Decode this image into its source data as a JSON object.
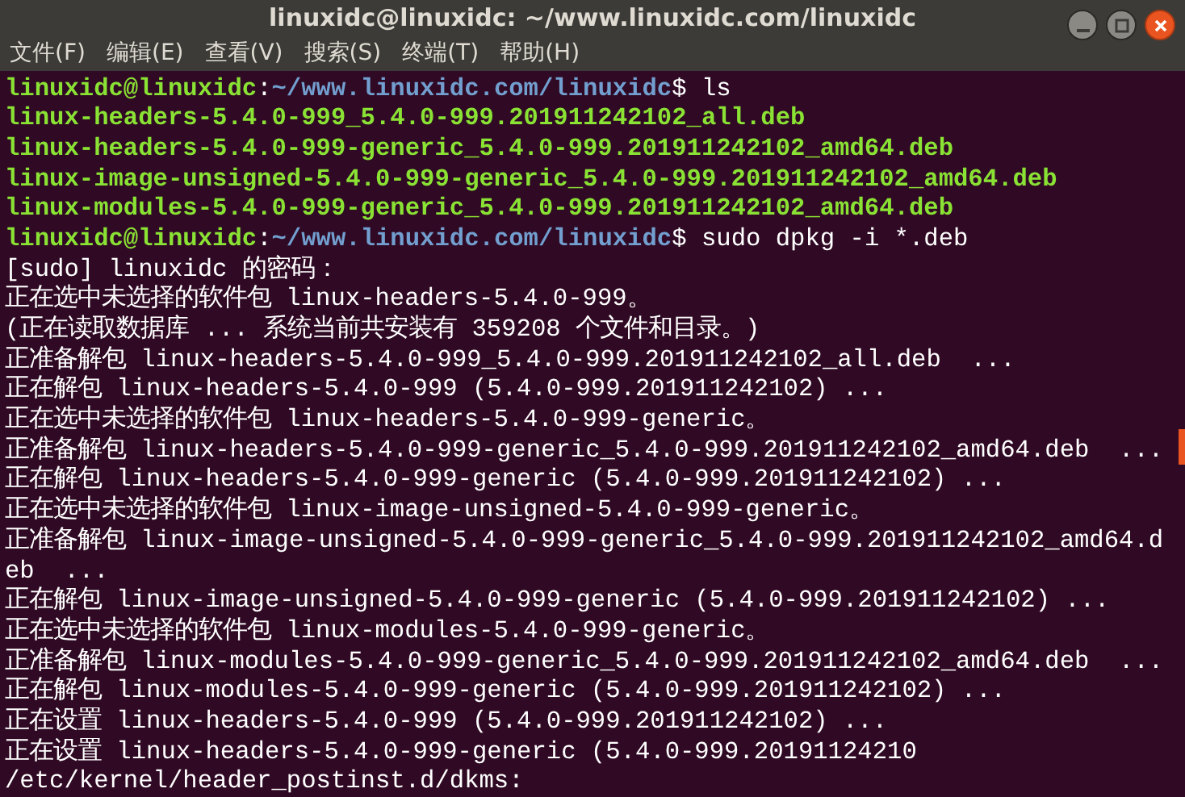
{
  "window": {
    "title": "linuxidc@linuxidc: ~/www.linuxidc.com/linuxidc"
  },
  "menu": [
    "文件(F)",
    "编辑(E)",
    "查看(V)",
    "搜索(S)",
    "终端(T)",
    "帮助(H)"
  ],
  "terminal": {
    "lines": [
      [
        {
          "kind": "user",
          "text": "linuxidc@linuxidc"
        },
        {
          "kind": "plain",
          "text": ":"
        },
        {
          "kind": "path",
          "text": "~/www.linuxidc.com/linuxidc"
        },
        {
          "kind": "plain",
          "text": "$ ls"
        }
      ],
      [
        {
          "kind": "file",
          "text": "linux-headers-5.4.0-999_5.4.0-999.201911242102_all.deb"
        }
      ],
      [
        {
          "kind": "file",
          "text": "linux-headers-5.4.0-999-generic_5.4.0-999.201911242102_amd64.deb"
        }
      ],
      [
        {
          "kind": "file",
          "text": "linux-image-unsigned-5.4.0-999-generic_5.4.0-999.201911242102_amd64.deb"
        }
      ],
      [
        {
          "kind": "file",
          "text": "linux-modules-5.4.0-999-generic_5.4.0-999.201911242102_amd64.deb"
        }
      ],
      [
        {
          "kind": "user",
          "text": "linuxidc@linuxidc"
        },
        {
          "kind": "plain",
          "text": ":"
        },
        {
          "kind": "path",
          "text": "~/www.linuxidc.com/linuxidc"
        },
        {
          "kind": "plain",
          "text": "$ sudo dpkg -i *.deb"
        }
      ],
      [
        {
          "kind": "plain",
          "text": "[sudo] linuxidc 的密码："
        }
      ],
      [
        {
          "kind": "plain",
          "text": "正在选中未选择的软件包 linux-headers-5.4.0-999。"
        }
      ],
      [
        {
          "kind": "plain",
          "text": "(正在读取数据库 ... 系统当前共安装有 359208 个文件和目录。)"
        }
      ],
      [
        {
          "kind": "plain",
          "text": "正准备解包 linux-headers-5.4.0-999_5.4.0-999.201911242102_all.deb  ..."
        }
      ],
      [
        {
          "kind": "plain",
          "text": "正在解包 linux-headers-5.4.0-999 (5.4.0-999.201911242102) ..."
        }
      ],
      [
        {
          "kind": "plain",
          "text": "正在选中未选择的软件包 linux-headers-5.4.0-999-generic。"
        }
      ],
      [
        {
          "kind": "plain",
          "text": "正准备解包 linux-headers-5.4.0-999-generic_5.4.0-999.201911242102_amd64.deb  ..."
        }
      ],
      [
        {
          "kind": "plain",
          "text": "正在解包 linux-headers-5.4.0-999-generic (5.4.0-999.201911242102) ..."
        }
      ],
      [
        {
          "kind": "plain",
          "text": "正在选中未选择的软件包 linux-image-unsigned-5.4.0-999-generic。"
        }
      ],
      [
        {
          "kind": "plain",
          "text": "正准备解包 linux-image-unsigned-5.4.0-999-generic_5.4.0-999.201911242102_amd64.d"
        }
      ],
      [
        {
          "kind": "plain",
          "text": "eb  ..."
        }
      ],
      [
        {
          "kind": "plain",
          "text": "正在解包 linux-image-unsigned-5.4.0-999-generic (5.4.0-999.201911242102) ..."
        }
      ],
      [
        {
          "kind": "plain",
          "text": "正在选中未选择的软件包 linux-modules-5.4.0-999-generic。"
        }
      ],
      [
        {
          "kind": "plain",
          "text": "正准备解包 linux-modules-5.4.0-999-generic_5.4.0-999.201911242102_amd64.deb  ..."
        }
      ],
      [
        {
          "kind": "plain",
          "text": "正在解包 linux-modules-5.4.0-999-generic (5.4.0-999.201911242102) ..."
        }
      ],
      [
        {
          "kind": "plain",
          "text": "正在设置 linux-headers-5.4.0-999 (5.4.0-999.201911242102) ..."
        }
      ],
      [
        {
          "kind": "plain",
          "text": "正在设置 linux-headers-5.4.0-999-generic (5.4.0-999.20191124210"
        }
      ],
      [
        {
          "kind": "plain",
          "text": "/etc/kernel/header_postinst.d/dkms:"
        }
      ]
    ]
  }
}
